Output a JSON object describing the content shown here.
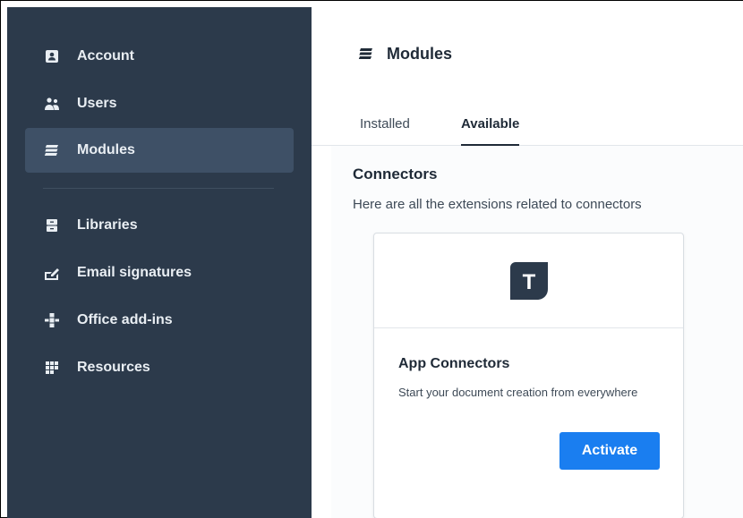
{
  "sidebar": {
    "items": [
      {
        "label": "Account",
        "icon": "account-icon"
      },
      {
        "label": "Users",
        "icon": "users-icon"
      },
      {
        "label": "Modules",
        "icon": "modules-icon",
        "active": true
      },
      {
        "label": "Libraries",
        "icon": "libraries-icon"
      },
      {
        "label": "Email signatures",
        "icon": "signature-icon"
      },
      {
        "label": "Office add-ins",
        "icon": "office-addins-icon"
      },
      {
        "label": "Resources",
        "icon": "resources-icon"
      }
    ]
  },
  "main": {
    "title": "Modules",
    "tabs": [
      {
        "label": "Installed"
      },
      {
        "label": "Available",
        "active": true
      }
    ],
    "section": {
      "title": "Connectors",
      "description": "Here are all the extensions related to connectors"
    },
    "card": {
      "logo_letter": "T",
      "title": "App Connectors",
      "description": "Start your document creation from everywhere",
      "button_label": "Activate"
    }
  },
  "colors": {
    "sidebar_bg": "#2c3a4b",
    "sidebar_active_bg": "#3e5066",
    "accent": "#1a7ef0",
    "logo_bg": "#2c3a4b"
  }
}
